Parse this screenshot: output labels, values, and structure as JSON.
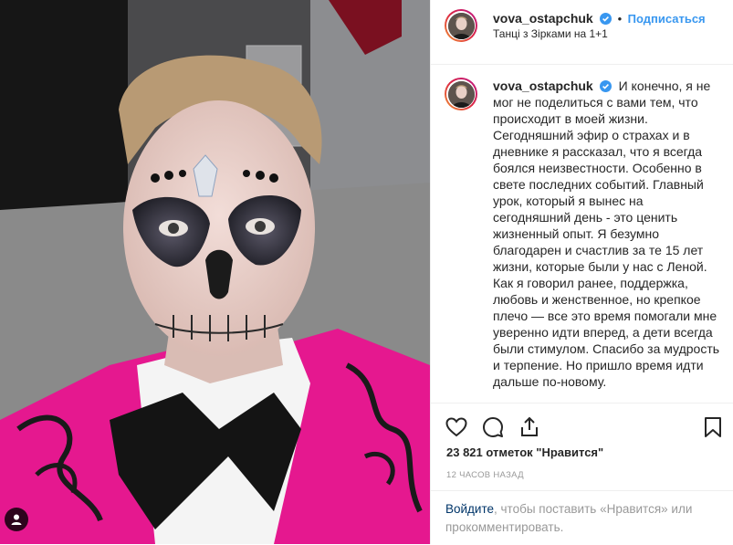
{
  "post": {
    "username": "vova_ostapchuk",
    "follow_label": "Подписаться",
    "separator": "•",
    "location": "Танці з Зірками на 1+1"
  },
  "caption": {
    "username": "vova_ostapchuk",
    "text": "И конечно, я не мог не поделиться с вами тем, что происходит в моей жизни. Сегодняшний эфир о страхах и в дневнике я рассказал, что я всегда боялся неизвестности. Особенно в свете последних событий. Главный урок, который я вынес на сегодняшний день - это ценить жизненный опыт. Я безумно благодарен и счастлив за те 15 лет жизни, которые были у нас с Леной. Как я говорил ранее, поддержка, любовь и женственное, но крепкое плечо — все это время помогали мне уверенно идти вперед, а дети всегда были стимулом. Спасибо за мудрость и терпение. Но пришло время идти дальше по-новому."
  },
  "stats": {
    "likes": "23 821 отметок \"Нравится\"",
    "time_ago": "12 часов назад"
  },
  "login": {
    "link": "Войдите",
    "rest": ", чтобы поставить «Нравится» или прокомментировать."
  },
  "icons": {
    "like": "heart-icon",
    "comment": "comment-icon",
    "share": "share-icon",
    "save": "bookmark-icon",
    "verified": "verified-badge-icon",
    "user_tag": "user-tag-icon"
  },
  "colors": {
    "link_blue": "#3897f0",
    "verified_blue": "#3897f0",
    "text": "#262626",
    "muted": "#999999",
    "border": "#efefef",
    "jacket_pink": "#e5188f"
  }
}
